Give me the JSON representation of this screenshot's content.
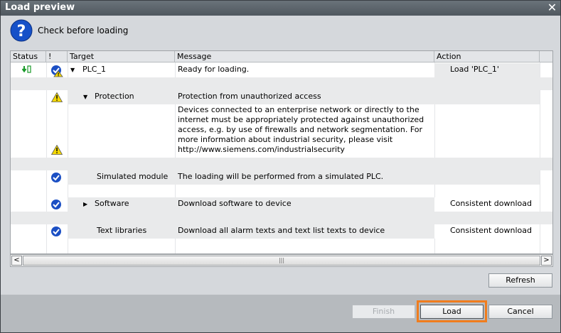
{
  "window": {
    "title": "Load preview"
  },
  "header": {
    "text": "Check before loading"
  },
  "columns": {
    "status": "Status",
    "alert": "!",
    "target": "Target",
    "message": "Message",
    "action": "Action"
  },
  "rows": [
    {
      "target": "PLC_1",
      "message": "Ready for loading.",
      "action": "Load 'PLC_1'"
    },
    {
      "target": "Protection",
      "message": "Protection from unauthorized access",
      "action": ""
    },
    {
      "target": "",
      "message": "Devices connected to an enterprise network or directly to the internet must be appropriately protected against unauthorized access, e.g. by use of firewalls and network segmentation. For more information about industrial security, please visit http://www.siemens.com/industrialsecurity",
      "action": ""
    },
    {
      "target": "Simulated module",
      "message": "The loading will be performed from a simulated PLC.",
      "action": ""
    },
    {
      "target": "Software",
      "message": "Download software to device",
      "action": "Consistent download"
    },
    {
      "target": "Text libraries",
      "message": "Download all alarm texts and text list texts to device",
      "action": "Consistent download"
    }
  ],
  "buttons": {
    "refresh": "Refresh",
    "finish": "Finish",
    "load": "Load",
    "cancel": "Cancel"
  },
  "colors": {
    "accent_highlight": "#f07d1e",
    "check_blue": "#1b4fc4",
    "warning_yellow": "#f5d800"
  },
  "icons": {
    "header": "question-icon",
    "close": "close-icon"
  }
}
